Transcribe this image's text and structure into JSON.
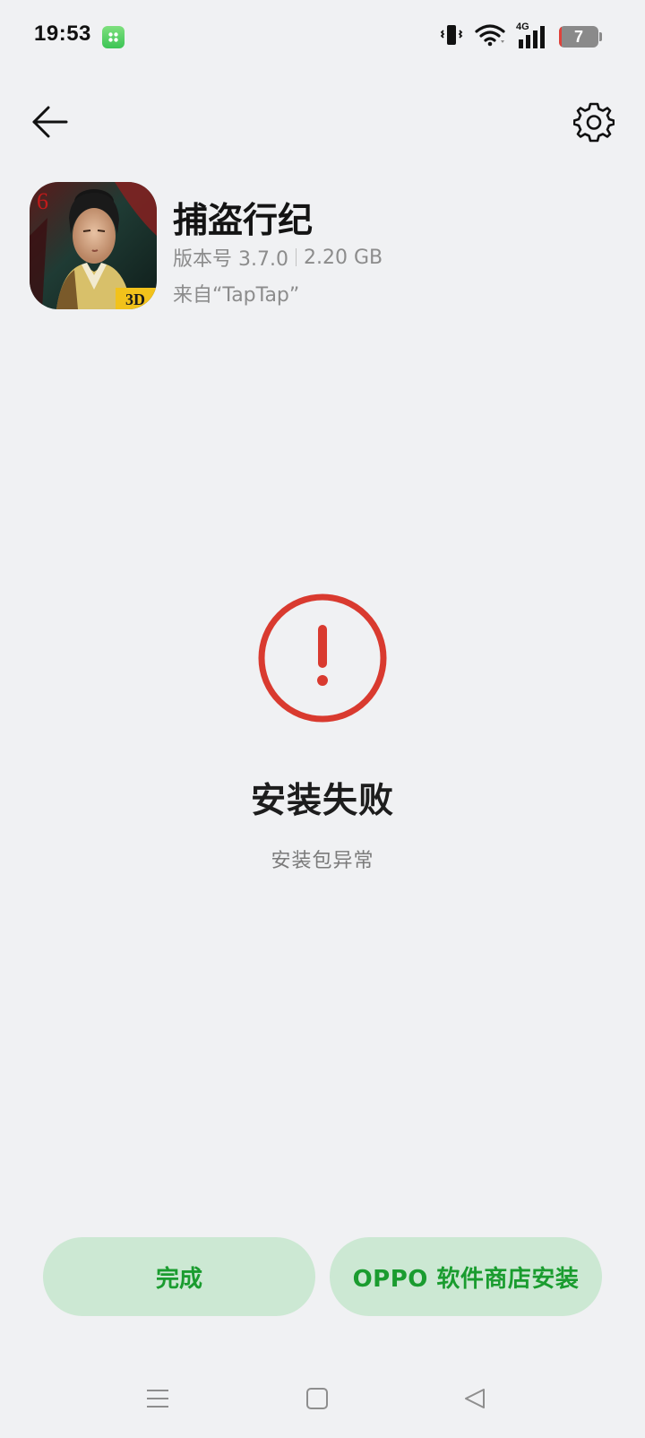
{
  "status_bar": {
    "time": "19:53",
    "network_label": "4G",
    "battery_level": "7",
    "battery_fraction": 0.07,
    "icons": [
      "app-notification-icon",
      "vibrate-icon",
      "wifi-icon",
      "signal-icon",
      "battery-icon"
    ]
  },
  "top_bar": {
    "back_icon": "arrow-left-icon",
    "settings_icon": "gear-icon"
  },
  "app": {
    "name": "捕盗行纪",
    "version": "版本号 3.7.0",
    "size": "2.20 GB",
    "source": "来自“TapTap”",
    "icon_badge_number": "6",
    "icon_badge_3d": "3D"
  },
  "result": {
    "icon": "exclamation-circle-icon",
    "title": "安装失败",
    "subtitle": "安装包异常",
    "accent_color": "#d93a2f"
  },
  "actions": {
    "done_label": "完成",
    "store_label": "OPPO 软件商店安装",
    "button_color": "#cce8d3",
    "button_text_color": "#1a9c2f"
  },
  "nav_bar": {
    "items": [
      "menu-icon",
      "home-icon",
      "back-triangle-icon"
    ]
  }
}
